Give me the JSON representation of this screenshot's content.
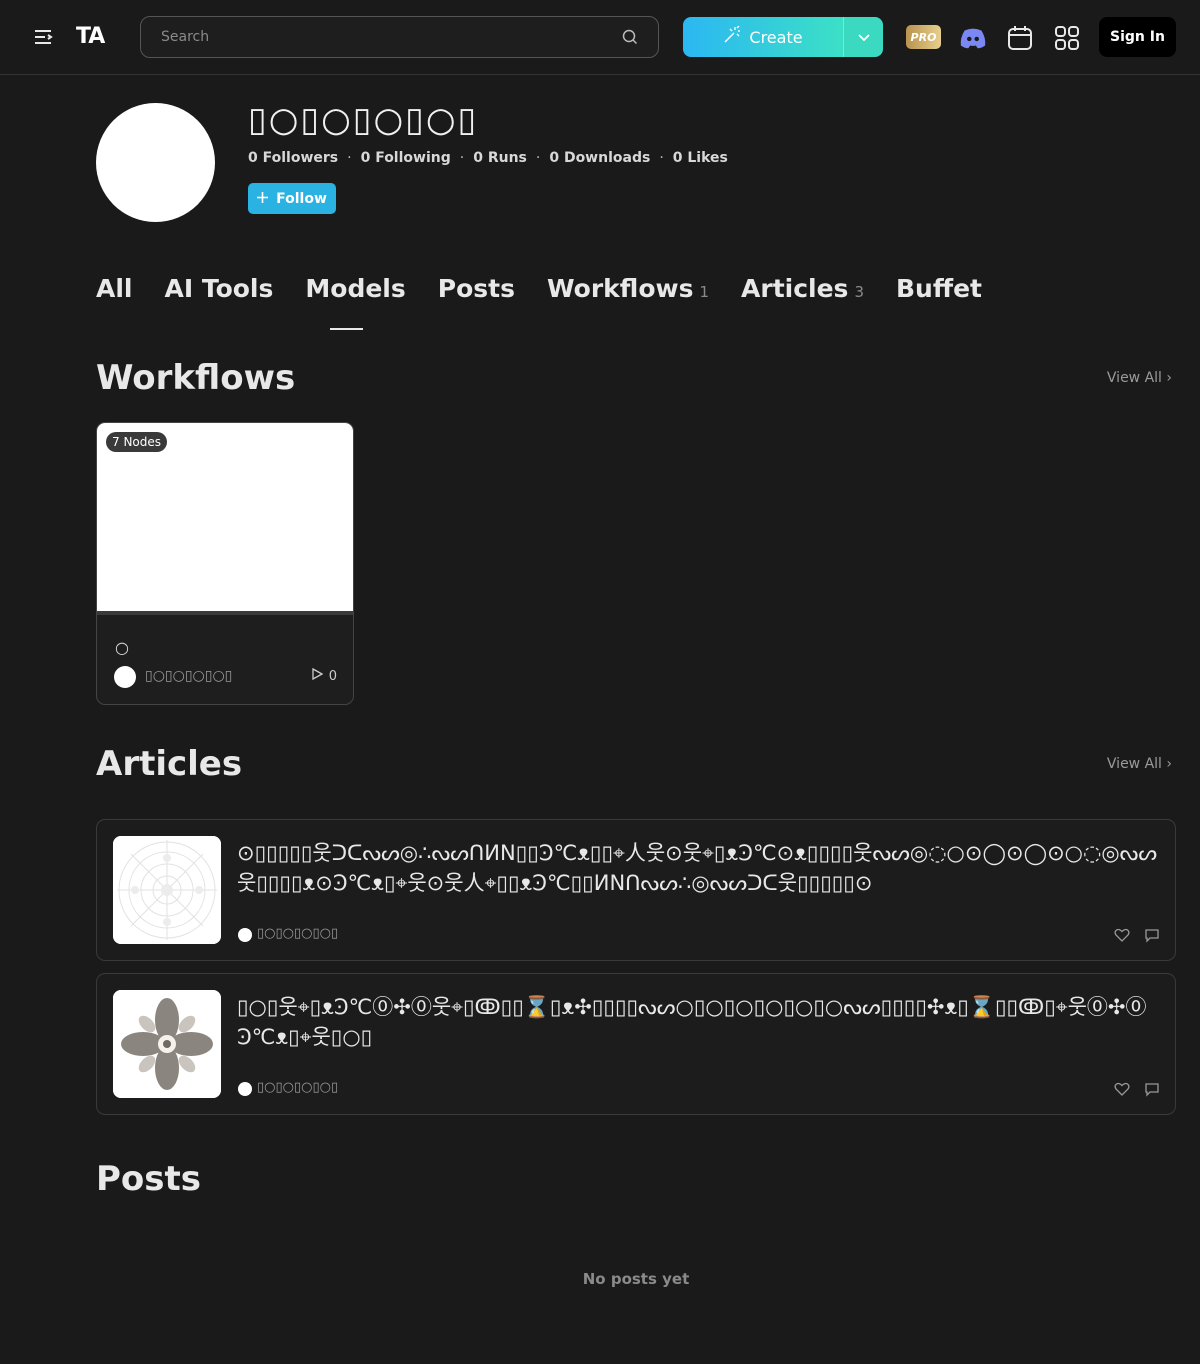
{
  "header": {
    "logo_text": "TA",
    "search_placeholder": "Search",
    "create_label": "Create",
    "pro_label": "PRO",
    "signin_label": "Sign In",
    "icons": [
      "menu-icon",
      "search-icon",
      "magic-wand-icon",
      "chevron-down-icon",
      "discord-icon",
      "calendar-icon",
      "apps-grid-icon"
    ],
    "colors": {
      "create_gradient_start": "#2bb7f2",
      "create_gradient_end": "#3ce0c6",
      "follow": "#2ab2e2"
    }
  },
  "profile": {
    "name": "▯○▯○▯○▯○▯",
    "stats": [
      "0 Followers",
      "0 Following",
      "0 Runs",
      "0 Downloads",
      "0 Likes"
    ],
    "follow_label": "Follow"
  },
  "tabs": [
    {
      "label": "All",
      "count": ""
    },
    {
      "label": "AI Tools",
      "count": ""
    },
    {
      "label": "Models",
      "count": "",
      "active": true
    },
    {
      "label": "Posts",
      "count": ""
    },
    {
      "label": "Workflows",
      "count": "1"
    },
    {
      "label": "Articles",
      "count": "3"
    },
    {
      "label": "Buffet",
      "count": ""
    }
  ],
  "workflows": {
    "title": "Workflows",
    "view_all": "View All",
    "cards": [
      {
        "badge": "7 Nodes",
        "title": "○",
        "author": "▯○▯○▯○▯○▯",
        "runs": "0"
      }
    ]
  },
  "articles": {
    "title": "Articles",
    "view_all": "View All",
    "items": [
      {
        "title": "⊙▯▯▯▯▯웃ᑐᑕᔓᔕ◎∴ᔓᔕᑎИN▯▯Ͽ℃ᴥ▯▯⌖人웃⊙웃⌖▯ᴥϿ℃⊙ᴥ▯▯▯▯웃ᔓᔕ◎◌○⊙◯⊙◯⊙○◌◎ᔓᔕ웃▯▯▯▯ᴥ⊙Ͽ℃ᴥ▯⌖웃⊙웃人⌖▯▯ᴥϿ℃▯▯ИNᑎᔓᔕ∴◎ᔓᔕᑐᑕ웃▯▯▯▯▯⊙",
        "author": "▯○▯○▯○▯○▯"
      },
      {
        "title": "▯○▯웃⌖▯ᴥϿ℃⓪✣⓪웃⌖▯ↂ▯▯⌛▯ᴥ✣▯▯▯▯ᔓᔕ○▯○▯○▯○▯○▯○ᔓᔕ▯▯▯▯✣ᴥ▯⌛▯▯ↂ▯⌖웃⓪✣⓪Ͽ℃ᴥ▯⌖웃▯○▯",
        "author": "▯○▯○▯○▯○▯"
      }
    ]
  },
  "posts": {
    "title": "Posts",
    "empty_text": "No posts yet"
  }
}
